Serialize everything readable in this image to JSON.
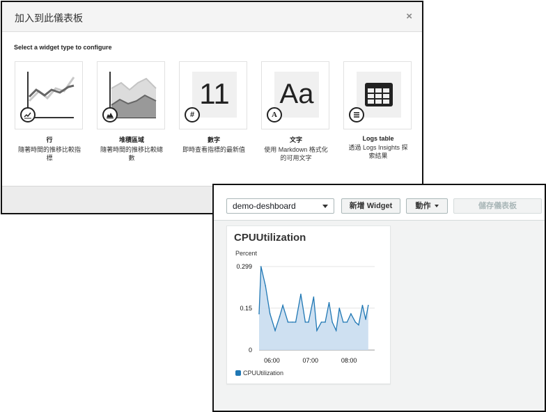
{
  "modal": {
    "title": "加入到此儀表板",
    "close_label": "×",
    "section_label": "Select a widget type to configure",
    "widgets": [
      {
        "name": "行",
        "desc": "隨著時間的推移比較指標",
        "icon": "line-chart-icon"
      },
      {
        "name": "堆積區域",
        "desc": "隨著時間的推移比較總數",
        "icon": "area-chart-icon"
      },
      {
        "name": "數字",
        "desc": "即時查看指標的最新值",
        "icon": "hash-icon",
        "thumb_text": "11",
        "badge_text": "#"
      },
      {
        "name": "文字",
        "desc": "使用 Markdown 格式化的可用文字",
        "icon": "text-icon",
        "thumb_text": "Aa",
        "badge_text": "A"
      },
      {
        "name": "Logs table",
        "desc": "透過 Logs Insights 探索結果",
        "icon": "list-icon"
      }
    ]
  },
  "dashboard": {
    "selector_value": "demo-deshboard",
    "add_widget_label": "新增 Widget",
    "actions_label": "動作",
    "save_label": "儲存儀表板",
    "widget": {
      "title": "CPUUtilization",
      "unit": "Percent",
      "legend": "CPUUtilization",
      "color": "#1f77b4"
    }
  },
  "chart_data": {
    "type": "area",
    "title": "CPUUtilization",
    "ylabel": "Percent",
    "ylim": [
      0,
      0.299
    ],
    "y_ticks": [
      0.299,
      0.15,
      0
    ],
    "x_ticks": [
      "06:00",
      "07:00",
      "08:00"
    ],
    "x_range_minutes": [
      -20,
      160
    ],
    "series": [
      {
        "name": "CPUUtilization",
        "x_minutes": [
          -20,
          -17,
          -10,
          -3,
          5,
          12,
          17,
          25,
          32,
          37,
          45,
          52,
          57,
          65,
          70,
          77,
          83,
          89,
          94,
          100,
          105,
          111,
          117,
          123,
          130,
          135,
          141,
          146,
          150
        ],
        "values": [
          0.13,
          0.299,
          0.23,
          0.13,
          0.07,
          0.12,
          0.16,
          0.1,
          0.1,
          0.1,
          0.2,
          0.1,
          0.1,
          0.19,
          0.07,
          0.1,
          0.1,
          0.17,
          0.1,
          0.07,
          0.15,
          0.1,
          0.1,
          0.13,
          0.1,
          0.09,
          0.16,
          0.11,
          0.16
        ]
      }
    ]
  }
}
